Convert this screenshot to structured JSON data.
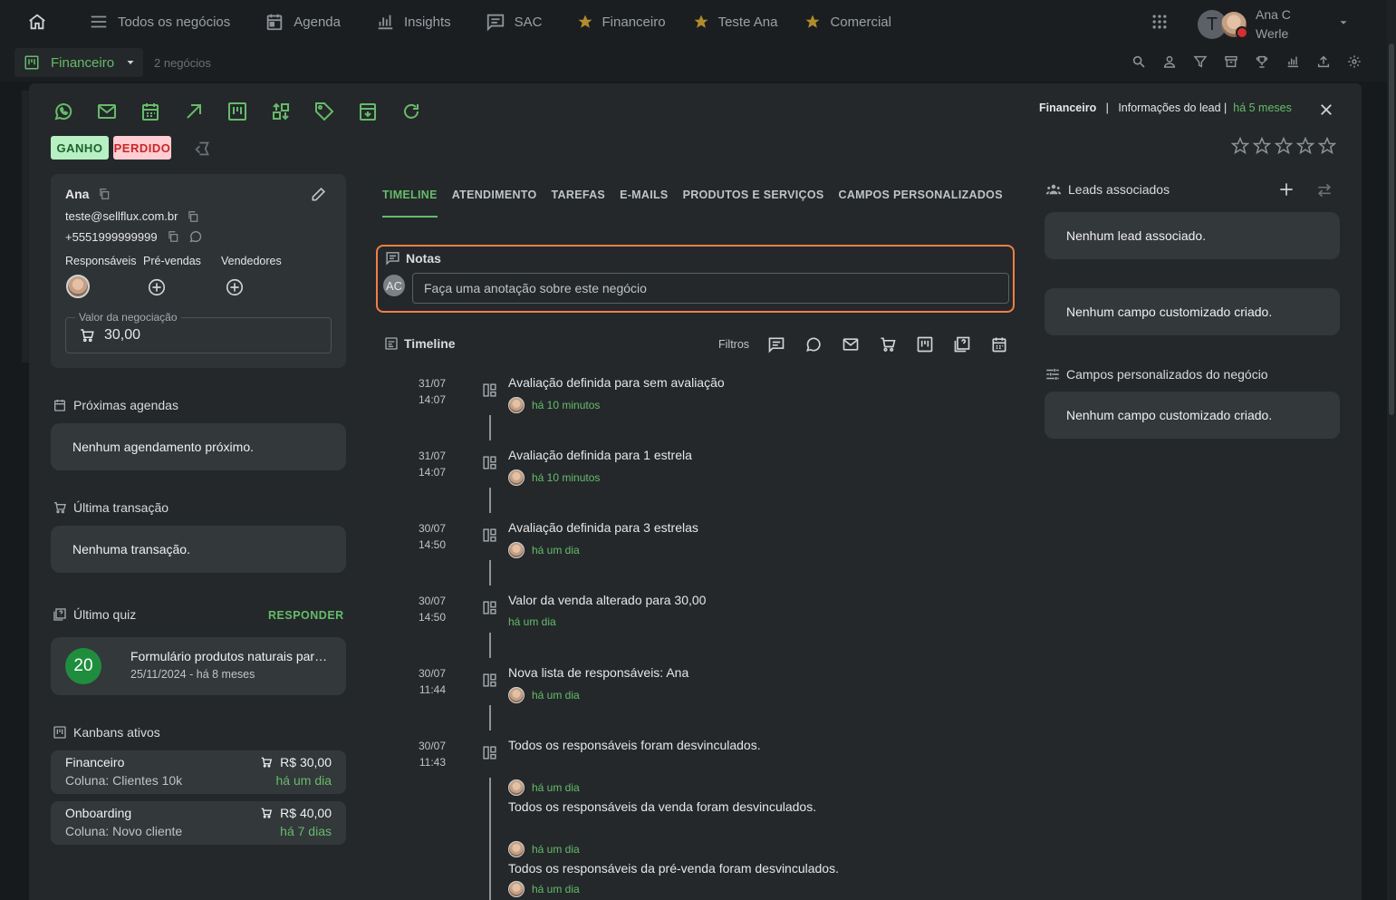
{
  "topbar": {
    "nav": [
      {
        "label": "Todos os negócios",
        "icon": "list-icon"
      },
      {
        "label": "Agenda",
        "icon": "calendar-icon"
      },
      {
        "label": "Insights",
        "icon": "bar-chart-icon"
      },
      {
        "label": "SAC",
        "icon": "chat-icon"
      }
    ],
    "favorites": [
      "Financeiro",
      "Teste Ana",
      "Comercial"
    ],
    "user_initial": "T",
    "user_name_line1": "Ana C",
    "user_name_line2": "Werle"
  },
  "subbar": {
    "board": "Financeiro",
    "count": "2 negócios"
  },
  "modal": {
    "chips": {
      "won": "GANHO",
      "lost": "PERDIDO"
    },
    "breadcrumb": {
      "board": "Financeiro",
      "separator": "|",
      "section": "Informações do lead |",
      "time": "há 5 meses"
    },
    "rating_stars": 0,
    "lead": {
      "name": "Ana",
      "email": "teste@sellflux.com.br",
      "phone": "+5551999999999",
      "roles": [
        "Responsáveis",
        "Pré-vendas",
        "Vendedores"
      ],
      "value_label": "Valor da negociação",
      "value": "30,00"
    },
    "next_schedules": {
      "title": "Próximas agendas",
      "empty": "Nenhum agendamento próximo."
    },
    "last_transaction": {
      "title": "Última transação",
      "empty": "Nenhuma transação."
    },
    "last_quiz": {
      "title": "Último quiz",
      "action": "RESPONDER",
      "score": "20",
      "name": "Formulário produtos naturais para saúde",
      "date": "25/11/2024 - há 8 meses"
    },
    "kanbans": {
      "title": "Kanbans ativos",
      "items": [
        {
          "name": "Financeiro",
          "column": "Coluna: Clientes 10k",
          "value": "R$ 30,00",
          "time": "há um dia"
        },
        {
          "name": "Onboarding",
          "column": "Coluna: Novo cliente",
          "value": "R$ 40,00",
          "time": "há 7 dias"
        }
      ]
    },
    "tabs": [
      "TIMELINE",
      "ATENDIMENTO",
      "TAREFAS",
      "E-MAILS",
      "PRODUTOS E SERVIÇOS",
      "CAMPOS PERSONALIZADOS"
    ],
    "notes": {
      "title": "Notas",
      "avatar": "AC",
      "placeholder": "Faça uma anotação sobre este negócio"
    },
    "timeline": {
      "title": "Timeline",
      "filters_label": "Filtros",
      "entries": [
        {
          "date": "31/07",
          "time": "14:07",
          "text": "Avaliação definida para sem avaliação",
          "ago": "há 10 minutos"
        },
        {
          "date": "31/07",
          "time": "14:07",
          "text": "Avaliação definida para 1 estrela",
          "ago": "há 10 minutos"
        },
        {
          "date": "30/07",
          "time": "14:50",
          "text": "Avaliação definida para 3 estrelas",
          "ago": "há um dia"
        },
        {
          "date": "30/07",
          "time": "14:50",
          "text": "Valor da venda alterado para 30,00",
          "ago": "há um dia"
        },
        {
          "date": "30/07",
          "time": "11:44",
          "text": "Nova lista de responsáveis: Ana",
          "ago": "há um dia"
        },
        {
          "date": "30/07",
          "time": "11:43",
          "text": "Todos os responsáveis foram desvinculados.",
          "ago": "há um dia",
          "sub": [
            {
              "text": "Todos os responsáveis da venda foram desvinculados.",
              "ago": "há um dia"
            },
            {
              "text": "Todos os responsáveis da pré-venda foram desvinculados.",
              "ago": "há um dia"
            }
          ]
        }
      ]
    },
    "right": {
      "leads_title": "Leads associados",
      "leads_empty": "Nenhum lead associado.",
      "custom_empty": "Nenhum campo customizado criado.",
      "deal_fields_title": "Campos personalizados do negócio",
      "deal_fields_empty": "Nenhum campo customizado criado."
    }
  }
}
